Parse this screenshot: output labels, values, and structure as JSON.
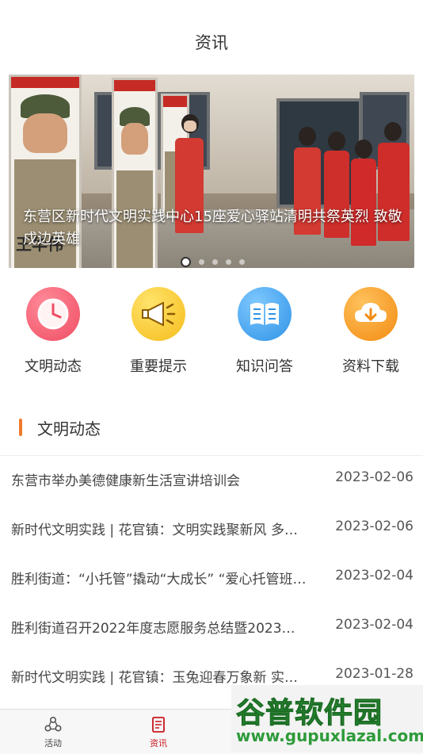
{
  "header": {
    "title": "资讯"
  },
  "banner": {
    "caption": "东营区新时代文明实践中心15座爱心驿站清明共祭英烈 致敬戍边英雄",
    "board_name": "王华伟",
    "dots": 5,
    "active_dot": 0
  },
  "quick_links": [
    {
      "label": "文明动态",
      "icon": "clock-icon",
      "color": "#f0566b"
    },
    {
      "label": "重要提示",
      "icon": "megaphone-icon",
      "color": "#f7c630"
    },
    {
      "label": "知识问答",
      "icon": "book-icon",
      "color": "#3ea2ee"
    },
    {
      "label": "资料下载",
      "icon": "cloud-download-icon",
      "color": "#f59a22"
    }
  ],
  "section": {
    "title": "文明动态",
    "accent": "#f07a2c"
  },
  "news": [
    {
      "title": "东营市举办美德健康新生活宣讲培训会",
      "date": "2023-02-06"
    },
    {
      "title": "新时代文明实践 | 花官镇：文明实践聚新风 多…",
      "date": "2023-02-06"
    },
    {
      "title": "胜利街道：“小托管”撬动“大成长” “爱心托管班…",
      "date": "2023-02-04"
    },
    {
      "title": "胜利街道召开2022年度志愿服务总结暨2023…",
      "date": "2023-02-04"
    },
    {
      "title": "新时代文明实践 | 花官镇：玉兔迎春万象新 实…",
      "date": "2023-01-28"
    }
  ],
  "tabbar": {
    "items": [
      {
        "label": "活动",
        "icon": "activity-icon"
      },
      {
        "label": "资讯",
        "icon": "news-icon",
        "active": true
      }
    ],
    "active_color": "#c8161e"
  },
  "watermark": {
    "main": "谷普软件园",
    "url": "www.gupuxlazal.com"
  }
}
